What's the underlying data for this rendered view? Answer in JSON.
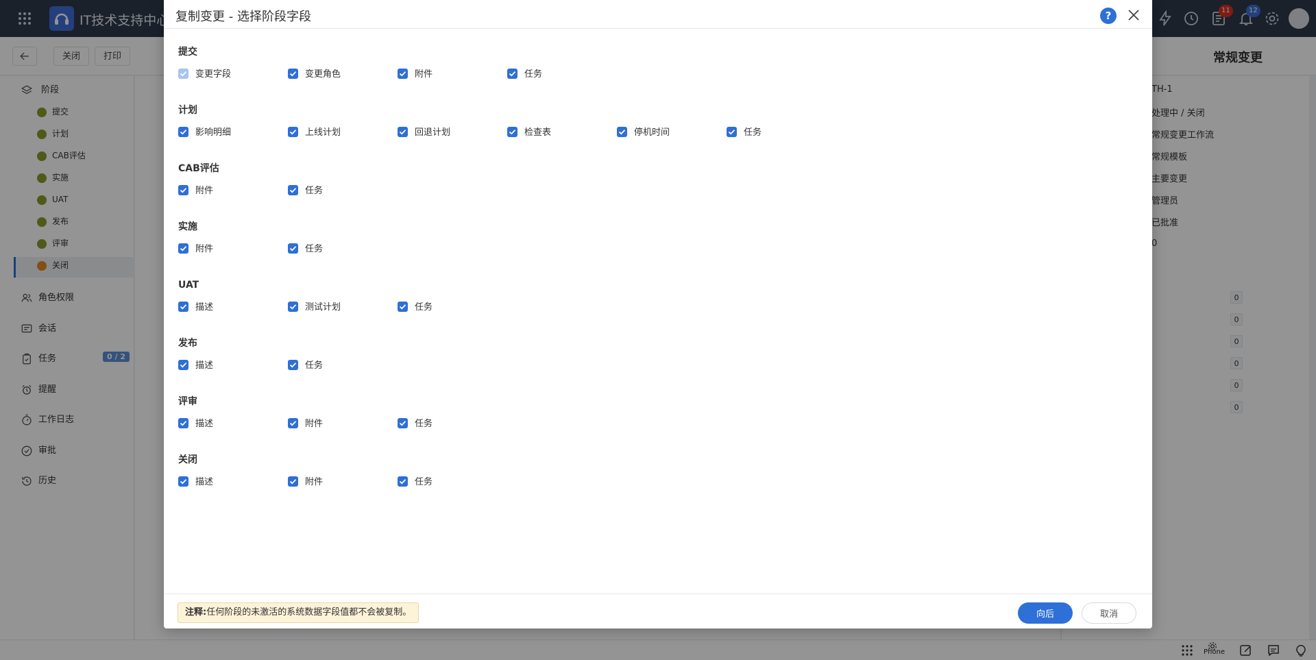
{
  "app": {
    "title": "IT技术支持中心",
    "notifications_a": "11",
    "notifications_b": "12"
  },
  "toolbar": {
    "close_label": "关闭",
    "print_label": "打印",
    "change_type": "常规变更"
  },
  "sidebar": {
    "stages_label": "阶段",
    "stages": [
      {
        "label": "提交",
        "status_color": "#8a9a2a"
      },
      {
        "label": "计划",
        "status_color": "#8a9a2a"
      },
      {
        "label": "CAB评估",
        "status_color": "#8a9a2a"
      },
      {
        "label": "实施",
        "status_color": "#8a9a2a"
      },
      {
        "label": "UAT",
        "status_color": "#8a9a2a"
      },
      {
        "label": "发布",
        "status_color": "#8a9a2a"
      },
      {
        "label": "评审",
        "status_color": "#8a9a2a"
      },
      {
        "label": "关闭",
        "status_color": "#e08a1e"
      }
    ],
    "sections": [
      {
        "label": "角色权限",
        "icon": "people-icon"
      },
      {
        "label": "会话",
        "icon": "chat-icon"
      },
      {
        "label": "任务",
        "icon": "clipboard-icon"
      },
      {
        "label": "提醒",
        "icon": "alarm-icon"
      },
      {
        "label": "工作日志",
        "icon": "timer-icon"
      },
      {
        "label": "审批",
        "icon": "check-circle-icon"
      },
      {
        "label": "历史",
        "icon": "history-icon"
      }
    ],
    "task_count": "0 / 2"
  },
  "right_panel": {
    "lines": [
      "TH-1",
      "处理中 / 关闭",
      "常规变更工作流",
      "常规模板",
      "主要变更",
      "管理员",
      "已批准",
      "0"
    ],
    "counts": [
      "0",
      "0",
      "0",
      "0",
      "0",
      "0"
    ]
  },
  "bottom": {
    "phone_label": "Phone"
  },
  "modal": {
    "title": "复制变更 - 选择阶段字段",
    "groups": [
      {
        "title": "提交",
        "fields": [
          {
            "label": "变更字段",
            "checked": true,
            "disabled": true
          },
          {
            "label": "变更角色",
            "checked": true
          },
          {
            "label": "附件",
            "checked": true
          },
          {
            "label": "任务",
            "checked": true
          }
        ]
      },
      {
        "title": "计划",
        "fields": [
          {
            "label": "影响明细",
            "checked": true
          },
          {
            "label": "上线计划",
            "checked": true
          },
          {
            "label": "回退计划",
            "checked": true
          },
          {
            "label": "检查表",
            "checked": true
          },
          {
            "label": "停机时间",
            "checked": true
          },
          {
            "label": "任务",
            "checked": true
          }
        ]
      },
      {
        "title": "CAB评估",
        "fields": [
          {
            "label": "附件",
            "checked": true
          },
          {
            "label": "任务",
            "checked": true
          }
        ]
      },
      {
        "title": "实施",
        "fields": [
          {
            "label": "附件",
            "checked": true
          },
          {
            "label": "任务",
            "checked": true
          }
        ]
      },
      {
        "title": "UAT",
        "fields": [
          {
            "label": "描述",
            "checked": true
          },
          {
            "label": "测试计划",
            "checked": true
          },
          {
            "label": "任务",
            "checked": true
          }
        ]
      },
      {
        "title": "发布",
        "fields": [
          {
            "label": "描述",
            "checked": true
          },
          {
            "label": "任务",
            "checked": true
          }
        ]
      },
      {
        "title": "评审",
        "fields": [
          {
            "label": "描述",
            "checked": true
          },
          {
            "label": "附件",
            "checked": true
          },
          {
            "label": "任务",
            "checked": true
          }
        ]
      },
      {
        "title": "关闭",
        "fields": [
          {
            "label": "描述",
            "checked": true
          },
          {
            "label": "附件",
            "checked": true
          },
          {
            "label": "任务",
            "checked": true
          }
        ]
      }
    ],
    "note_prefix": "注释:",
    "note_text": "任何阶段的未激活的系统数据字段值都不会被复制。",
    "next_label": "向后",
    "cancel_label": "取消"
  }
}
